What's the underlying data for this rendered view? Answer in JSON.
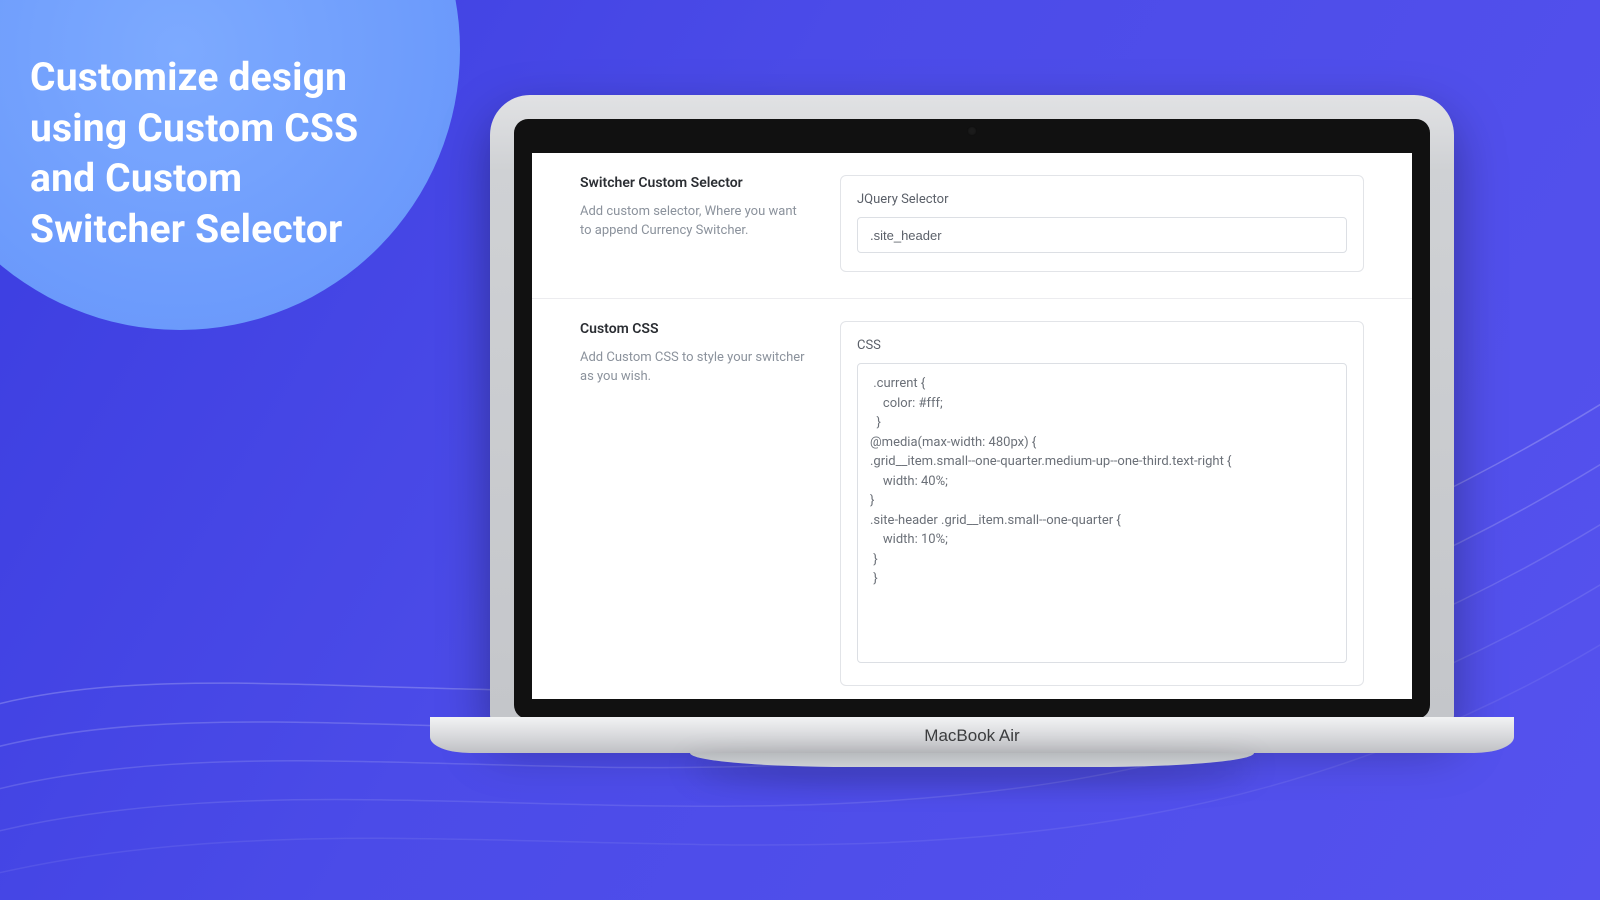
{
  "headline": "Customize design using Custom CSS and Custom Switcher Selector",
  "laptop_model": "MacBook Air",
  "selector_section": {
    "title": "Switcher Custom Selector",
    "description": "Add custom selector, Where you want to append Currency Switcher.",
    "field_label": "JQuery Selector",
    "value": ".site_header"
  },
  "css_section": {
    "title": "Custom CSS",
    "description": "Add Custom CSS to style your switcher as you wish.",
    "field_label": "CSS",
    "value": " .current {\n    color: #fff;\n  }\n@media(max-width: 480px) {\n.grid__item.small--one-quarter.medium-up--one-third.text-right {\n    width: 40%;\n}\n.site-header .grid__item.small--one-quarter {\n    width: 10%;\n }\n }"
  }
}
